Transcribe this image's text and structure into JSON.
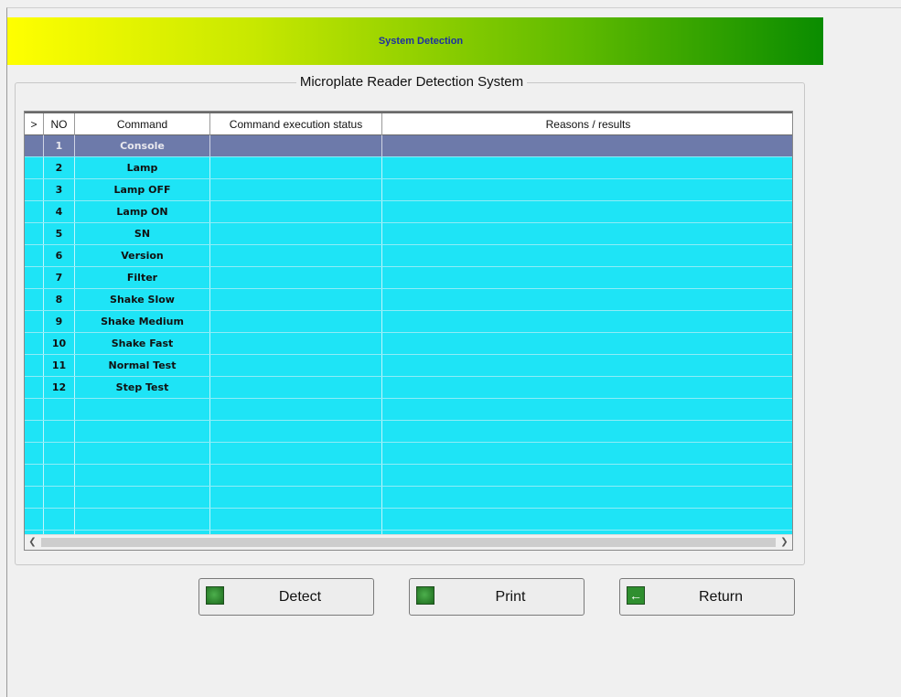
{
  "banner": {
    "title": "System Detection"
  },
  "group": {
    "title": "Microplate Reader Detection System"
  },
  "table": {
    "columns": [
      ">",
      "NO",
      "Command",
      "Command execution status",
      "Reasons / results"
    ],
    "rows": [
      {
        "no": "1",
        "command": "Console",
        "status": "",
        "result": ""
      },
      {
        "no": "2",
        "command": "Lamp",
        "status": "",
        "result": ""
      },
      {
        "no": "3",
        "command": "Lamp OFF",
        "status": "",
        "result": ""
      },
      {
        "no": "4",
        "command": "Lamp ON",
        "status": "",
        "result": ""
      },
      {
        "no": "5",
        "command": "SN",
        "status": "",
        "result": ""
      },
      {
        "no": "6",
        "command": "Version",
        "status": "",
        "result": ""
      },
      {
        "no": "7",
        "command": "Filter",
        "status": "",
        "result": ""
      },
      {
        "no": "8",
        "command": "Shake Slow",
        "status": "",
        "result": ""
      },
      {
        "no": "9",
        "command": "Shake Medium",
        "status": "",
        "result": ""
      },
      {
        "no": "10",
        "command": "Shake Fast",
        "status": "",
        "result": ""
      },
      {
        "no": "11",
        "command": "Normal Test",
        "status": "",
        "result": ""
      },
      {
        "no": "12",
        "command": "Step Test",
        "status": "",
        "result": ""
      },
      {
        "no": "",
        "command": "",
        "status": "",
        "result": ""
      },
      {
        "no": "",
        "command": "",
        "status": "",
        "result": ""
      },
      {
        "no": "",
        "command": "",
        "status": "",
        "result": ""
      },
      {
        "no": "",
        "command": "",
        "status": "",
        "result": ""
      },
      {
        "no": "",
        "command": "",
        "status": "",
        "result": ""
      },
      {
        "no": "",
        "command": "",
        "status": "",
        "result": ""
      },
      {
        "no": "",
        "command": "",
        "status": "",
        "result": ""
      }
    ],
    "selected_row": 0,
    "scroll_left_icon": "chevron-left-icon",
    "scroll_right_icon": "chevron-right-icon"
  },
  "buttons": {
    "detect": {
      "label": "Detect",
      "icon": "green-square-icon"
    },
    "print": {
      "label": "Print",
      "icon": "green-square-icon"
    },
    "return": {
      "label": "Return",
      "icon": "arrow-left-icon"
    }
  },
  "colors": {
    "grid_bg": "#1ee4f6",
    "selected_row": "#6d7aaa",
    "banner_start": "#ffff00",
    "banner_end": "#0a8c00",
    "banner_text": "#1d2fa0"
  }
}
